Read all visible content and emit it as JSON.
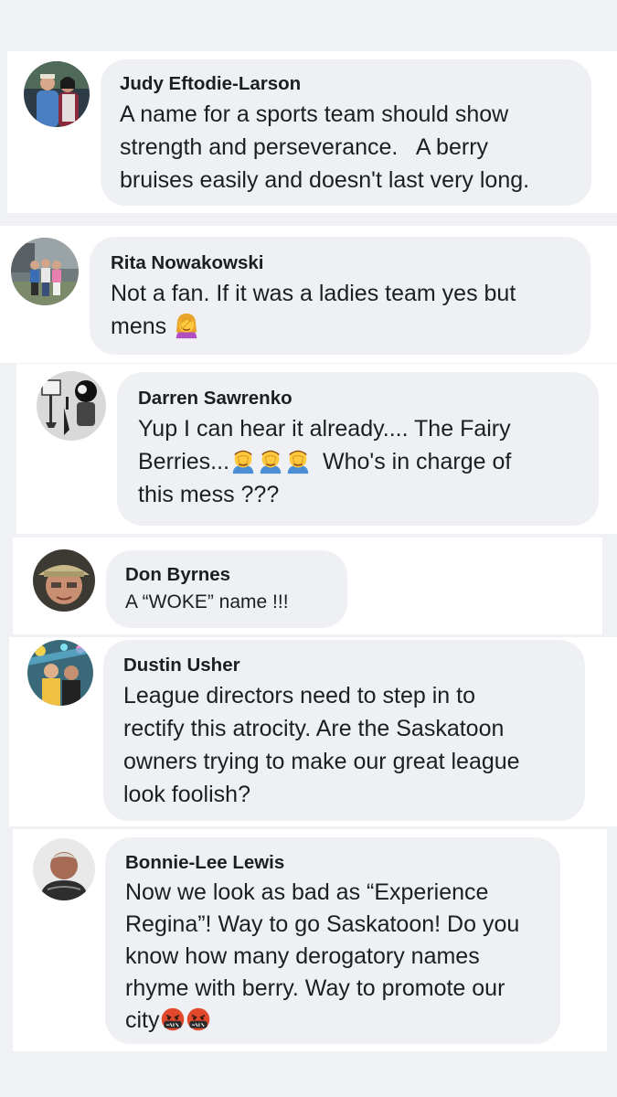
{
  "comments": [
    {
      "name": "Judy Eftodie-Larson",
      "lines": [
        "A name for a sports team should show",
        "strength and perseverance.   A berry",
        "bruises easily and doesn't last very long."
      ]
    },
    {
      "name": "Rita Nowakowski",
      "lines": [
        "Not a fan. If it was a ladies team yes but",
        "mens"
      ],
      "emoji": "woman-facepalming-emoji"
    },
    {
      "name": "Darren Sawrenko",
      "lines": [
        "Yup I can hear it already.... The Fairy",
        "Berries...",
        "Who's in charge of",
        "this mess ???"
      ],
      "emoji": "man-facepalming-emoji"
    },
    {
      "name": "Don Byrnes",
      "lines": [
        "A “WOKE” name !!!"
      ]
    },
    {
      "name": "Dustin Usher",
      "lines": [
        "League directors need to step in to",
        "rectify this atrocity. Are the Saskatoon",
        "owners trying to make our great league",
        "look foolish?"
      ]
    },
    {
      "name": "Bonnie-Lee Lewis",
      "lines": [
        "Now we look as bad as “Experience",
        "Regina”! Way to go Saskatoon! Do you",
        "know how many derogatory names",
        "rhyme with berry. Way to promote our",
        "city"
      ],
      "emoji": "face-with-symbols-on-mouth-emoji"
    }
  ],
  "colors": {
    "page_background": "#f0f1f5",
    "card_background": "#ffffff",
    "bubble_background": "#eef0f3",
    "text": "#1c1e21"
  }
}
